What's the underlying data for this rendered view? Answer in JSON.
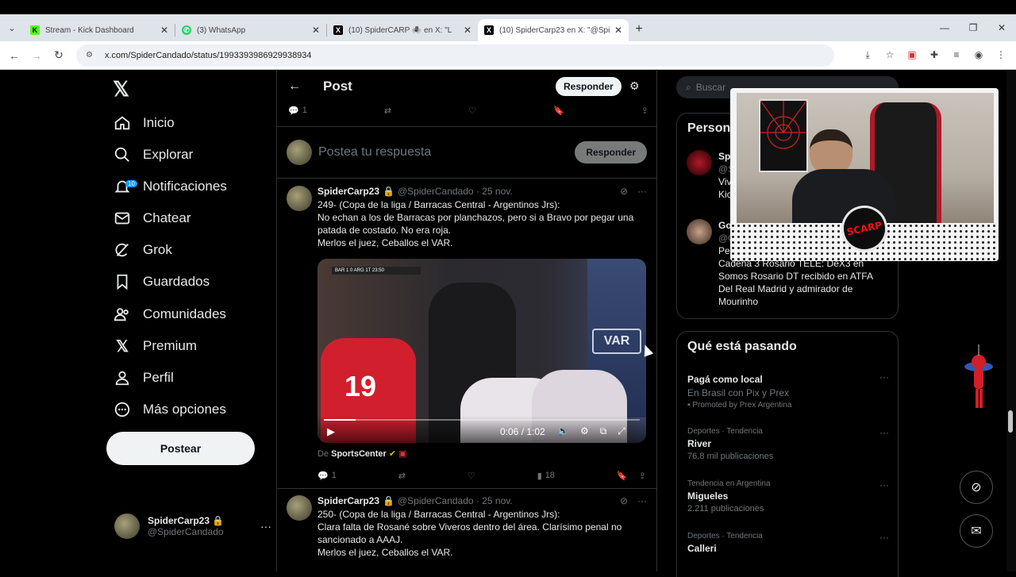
{
  "browser": {
    "tabs": [
      {
        "title": "Stream - Kick Dashboard",
        "fav": "K",
        "fav_color": "#53fc18"
      },
      {
        "title": "(3) WhatsApp",
        "fav": "✆",
        "fav_color": "#25d366"
      },
      {
        "title": "(10) SpiderCARP 🕷️ en X: \"L",
        "fav": "X",
        "fav_color": "#000000"
      },
      {
        "title": "(10) SpiderCarp23 en X: \"@Spic",
        "fav": "X",
        "fav_color": "#000000"
      }
    ],
    "url": "x.com/SpiderCandado/status/1993393986929938934"
  },
  "nav": {
    "items": [
      {
        "label": "Inicio",
        "icon": "home-icon"
      },
      {
        "label": "Explorar",
        "icon": "search-icon"
      },
      {
        "label": "Notificaciones",
        "icon": "bell-icon",
        "badge": "10"
      },
      {
        "label": "Chatear",
        "icon": "mail-icon"
      },
      {
        "label": "Grok",
        "icon": "grok-icon"
      },
      {
        "label": "Guardados",
        "icon": "bookmark-icon"
      },
      {
        "label": "Comunidades",
        "icon": "people-icon"
      },
      {
        "label": "Premium",
        "icon": "x-icon"
      },
      {
        "label": "Perfil",
        "icon": "person-icon"
      },
      {
        "label": "Más opciones",
        "icon": "more-circle-icon"
      }
    ],
    "post_button": "Postear",
    "account": {
      "display_name": "SpiderCarp23 🔒",
      "handle": "@SpiderCandado"
    }
  },
  "header": {
    "title": "Post",
    "reply_button": "Responder"
  },
  "top_actions": {
    "replies": "1"
  },
  "reply_box": {
    "placeholder": "Postea tu respuesta",
    "button": "Responder"
  },
  "tweets": [
    {
      "display_name": "SpiderCarp23",
      "meta": "@SpiderCandado · 25 nov.",
      "text": "249- (Copa de la liga / Barracas Central - Argentinos Jrs):\nNo echan a los de Barracas por planchazos, pero si a Bravo por pegar una patada de costado. No era roja.\nMerlos el juez, Ceballos el VAR.",
      "video": {
        "time": "0:06 / 1:02",
        "progress": 0.1,
        "score": "BAR 1 0 ARG 1T 23:50",
        "var_label": "VAR",
        "shirt_number": "19"
      },
      "from_label": "De",
      "from_name": "SportsCenter",
      "replies": "1",
      "views": "18"
    },
    {
      "display_name": "SpiderCarp23",
      "meta": "@SpiderCandado · 25 nov.",
      "text": "250- (Copa de la liga / Barracas Central - Argentinos Jrs):\nClara falta de Rosané sobre Viveros dentro del área. Clarísimo penal no sancionado a AAAJ.\nMerlos el juez, Ceballos el VAR."
    }
  ],
  "right": {
    "search_placeholder": "Buscar",
    "who_to_follow_title": "Person",
    "who": [
      {
        "name": "Sp",
        "handle": "@S",
        "bio": "Viv\nKic"
      },
      {
        "name": "Go",
        "handle": "@C",
        "bio": "Per\nCadena 3 Rosario TELE: DeX3 en\nSomos Rosario DT recibido en ATFA\nDel Real Madrid y admirador de\nMourinho"
      }
    ],
    "trending_title": "Qué está pasando",
    "trends": [
      {
        "category": "",
        "name": "Pagá como local",
        "count": "En Brasil con Pix y Prex",
        "promo": "Promoted by Prex Argentina"
      },
      {
        "category": "Deportes · Tendencia",
        "name": "River",
        "count": "76,8 mil publicaciones"
      },
      {
        "category": "Tendencia en Argentina",
        "name": "Migueles",
        "count": "2.211 publicaciones"
      },
      {
        "category": "Deportes · Tendencia",
        "name": "Calleri",
        "count": ""
      }
    ]
  },
  "overlay": {
    "logo_text": "SCARP"
  }
}
